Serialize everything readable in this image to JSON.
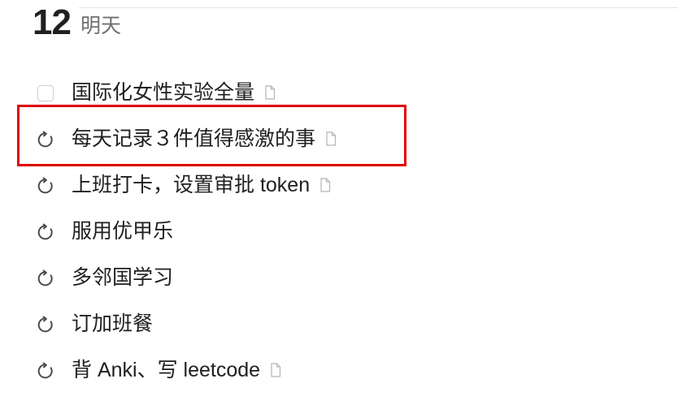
{
  "day_header": {
    "number": "12",
    "label": "明天"
  },
  "tasks": [
    {
      "title": "国际化女性实验全量",
      "status_icon": "checkbox-empty-icon",
      "has_note": true
    },
    {
      "title": "每天记录３件值得感激的事",
      "status_icon": "repeat-icon",
      "has_note": true
    },
    {
      "title": "上班打卡，设置审批 token",
      "status_icon": "repeat-icon",
      "has_note": true
    },
    {
      "title": "服用优甲乐",
      "status_icon": "repeat-icon",
      "has_note": false
    },
    {
      "title": "多邻国学习",
      "status_icon": "repeat-icon",
      "has_note": false
    },
    {
      "title": "订加班餐",
      "status_icon": "repeat-icon",
      "has_note": false
    },
    {
      "title": "背 Anki、写 leetcode",
      "status_icon": "repeat-icon",
      "has_note": true
    }
  ],
  "colors": {
    "text": "#202020",
    "muted_text": "#707070",
    "icon": "#4a4a4a",
    "checkbox_border": "#cfcfcf",
    "highlight": "#e10000"
  }
}
